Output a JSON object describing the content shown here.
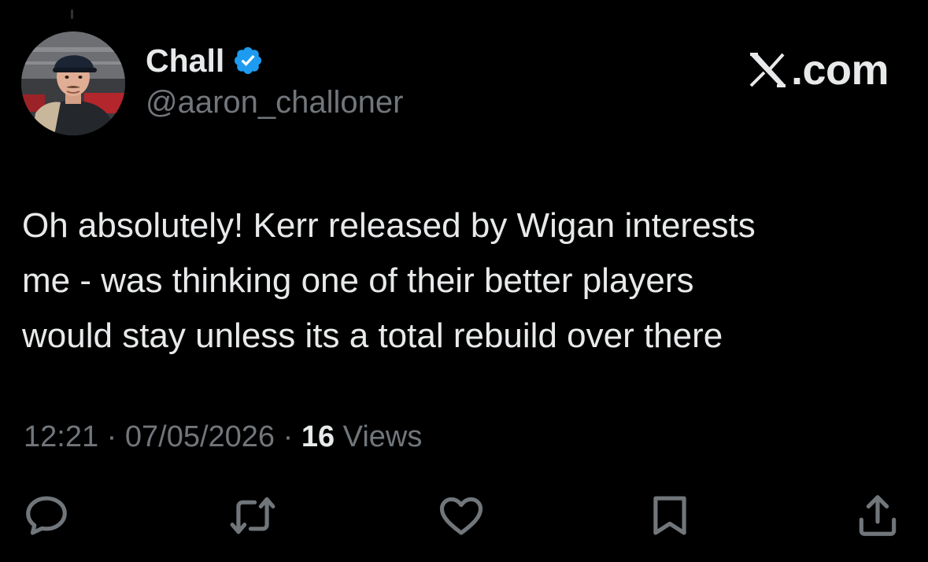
{
  "author": {
    "display_name": "Chall",
    "handle": "@aaron_challoner",
    "verified": true,
    "verified_color": "#1d9bf0"
  },
  "brand": {
    "text": ".com",
    "icon": "x-logo-icon"
  },
  "tweet": {
    "lines": [
      "Oh absolutely! Kerr released by Wigan interests",
      "me - was thinking one of their better players",
      "would stay unless its a total rebuild over there"
    ]
  },
  "meta": {
    "time": "12:21",
    "separator": " · ",
    "date": "07/05/2026",
    "views_count": "16",
    "views_label": " Views"
  },
  "actions": [
    {
      "name": "reply",
      "icon": "reply-icon"
    },
    {
      "name": "repost",
      "icon": "repost-icon"
    },
    {
      "name": "like",
      "icon": "heart-icon"
    },
    {
      "name": "bookmark",
      "icon": "bookmark-icon"
    },
    {
      "name": "share",
      "icon": "share-icon"
    }
  ],
  "colors": {
    "background": "#000000",
    "text_primary": "#e7e9ea",
    "text_secondary": "#71767b"
  }
}
